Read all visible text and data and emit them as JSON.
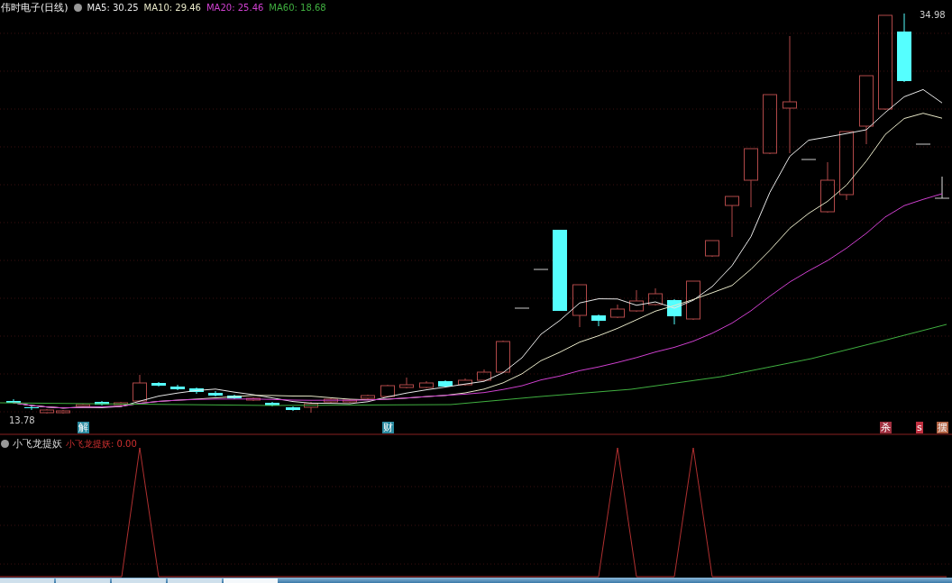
{
  "chart": {
    "title": "伟时电子(日线)",
    "moving_averages": [
      {
        "label": "MA5: 30.25",
        "color": "#e8e8e8"
      },
      {
        "label": "MA10: 29.46",
        "color": "#e8e8c8"
      },
      {
        "label": "MA20: 25.46",
        "color": "#d040d0"
      },
      {
        "label": "MA60: 18.68",
        "color": "#40b040"
      }
    ],
    "high_label": "34.98",
    "low_label": "13.78",
    "event_markers": [
      {
        "text": "解",
        "color": "#2a8aa0"
      },
      {
        "text": "财",
        "color": "#2a8aa0"
      },
      {
        "text": "杀",
        "color": "#a03040"
      },
      {
        "text": "s",
        "color": "#c03040"
      },
      {
        "text": "摆",
        "color": "#b06040"
      }
    ]
  },
  "indicator": {
    "name": "小飞龙提妖",
    "reading": "小飞龙提妖: 0.00"
  },
  "taskbar": {
    "tabs": [
      {
        "selected": false
      },
      {
        "selected": false
      },
      {
        "selected": false
      },
      {
        "selected": false
      },
      {
        "selected": true
      }
    ]
  }
}
